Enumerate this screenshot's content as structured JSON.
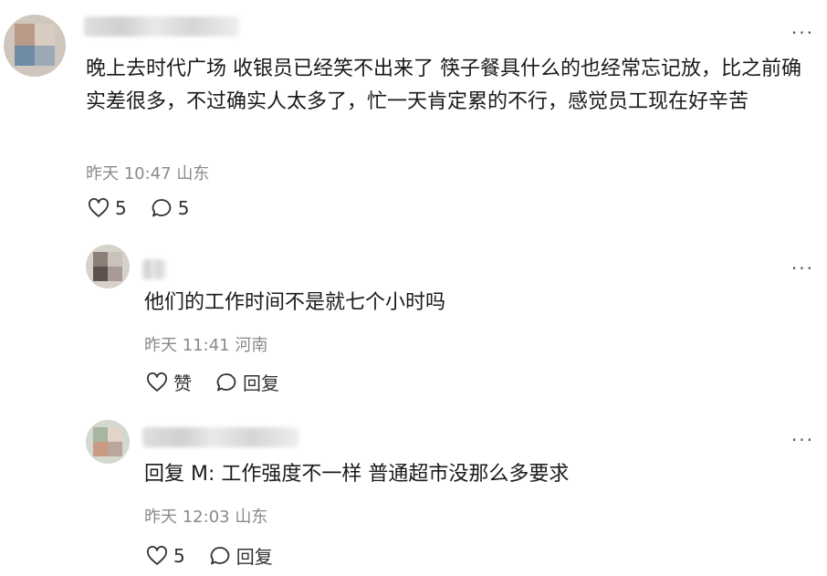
{
  "comments": [
    {
      "text": "晚上去时代广场 收银员已经笑不出来了 筷子餐具什么的也经常忘记放，比之前确实差很多，不过确实人太多了，忙一天肯定累的不行，感觉员工现在好辛苦",
      "meta": "昨天 10:47 山东",
      "like_label": "5",
      "reply_label": "5",
      "more_label": "···"
    },
    {
      "text": "他们的工作时间不是就七个小时吗",
      "meta": "昨天 11:41 河南",
      "like_label": "赞",
      "reply_label": "回复",
      "more_label": "···"
    },
    {
      "reply_prefix": "回复 M:",
      "text": " 工作强度不一样 普通超市没那么多要求",
      "meta": "昨天 12:03 山东",
      "like_label": "5",
      "reply_label": "回复",
      "more_label": "···"
    }
  ]
}
